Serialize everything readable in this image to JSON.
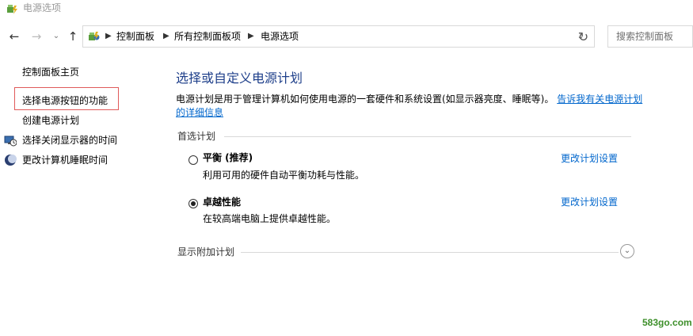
{
  "window": {
    "title": "电源选项"
  },
  "address_bar": {
    "breadcrumbs": [
      "控制面板",
      "所有控制面板项",
      "电源选项"
    ],
    "search_placeholder": "搜索控制面板"
  },
  "sidebar": {
    "items": [
      {
        "label": "控制面板主页"
      },
      {
        "label": "选择电源按钮的功能"
      },
      {
        "label": "创建电源计划"
      },
      {
        "label": "选择关闭显示器的时间",
        "icon": "monitor-clock-icon"
      },
      {
        "label": "更改计算机睡眠时间",
        "icon": "moon-icon"
      }
    ]
  },
  "main": {
    "heading": "选择或自定义电源计划",
    "description": "电源计划是用于管理计算机如何使用电源的一套硬件和系统设置(如显示器亮度、睡眠等)。",
    "more_info_link": "告诉我有关电源计划的详细信息",
    "preferred_section": "首选计划",
    "plans": [
      {
        "name": "平衡 (推荐)",
        "desc": "利用可用的硬件自动平衡功耗与性能。",
        "change_link": "更改计划设置",
        "selected": false
      },
      {
        "name": "卓越性能",
        "desc": "在较高端电脑上提供卓越性能。",
        "change_link": "更改计划设置",
        "selected": true
      }
    ],
    "additional_section": "显示附加计划"
  },
  "watermark": "583go.com",
  "colors": {
    "heading": "#1e3f8a",
    "link": "#0066cc",
    "highlight_border": "#e05a5a",
    "watermark": "#3d8f2a"
  }
}
